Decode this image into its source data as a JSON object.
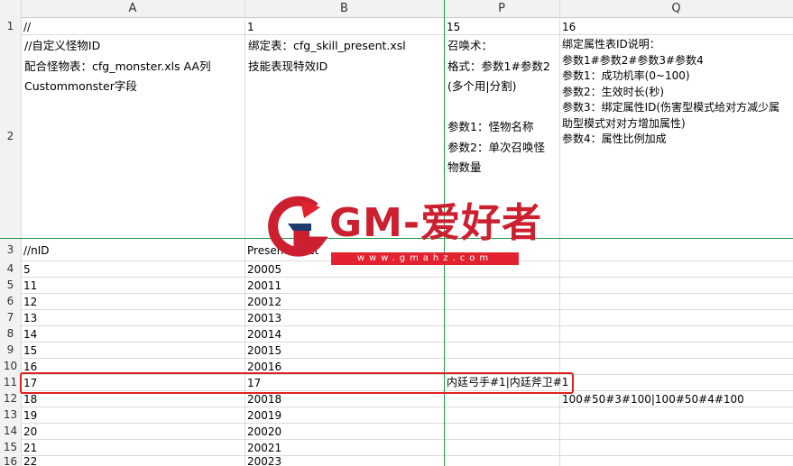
{
  "columns": [
    "A",
    "B",
    "P",
    "Q"
  ],
  "row_numbers": [
    "1",
    "2",
    "3",
    "4",
    "5",
    "6",
    "7",
    "8",
    "9",
    "10",
    "11",
    "12",
    "13",
    "14",
    "15",
    "16"
  ],
  "row1": {
    "A": "//",
    "B": "1",
    "P": "15",
    "Q": "16"
  },
  "row2": {
    "A": [
      "//自定义怪物ID",
      "配合怪物表：cfg_monster.xls  AA列",
      "Custommonster字段"
    ],
    "B": [
      "绑定表：cfg_skill_present.xsl",
      "技能表现特效ID"
    ],
    "P": [
      "召唤术：",
      "格式：参数1#参数2",
      "(多个用|分割)",
      "",
      "参数1：怪物名称",
      "参数2：单次召唤怪",
      "物数量"
    ],
    "Q": [
      "绑定属性表ID说明：",
      "参数1#参数2#参数3#参数4",
      "参数1：成功机率(0~100)",
      "参数2：生效时长(秒)",
      "参数3：绑定属性ID(伤害型模式给对方减少属",
      "助型模式对对方增加属性)",
      "参数4：属性比例加成"
    ]
  },
  "row3": {
    "A": "//nID",
    "B": "Presenteffect"
  },
  "data_rows": [
    {
      "A": "5",
      "B": "20005",
      "P": "",
      "Q": ""
    },
    {
      "A": "11",
      "B": "20011",
      "P": "",
      "Q": ""
    },
    {
      "A": "12",
      "B": "20012",
      "P": "",
      "Q": ""
    },
    {
      "A": "13",
      "B": "20013",
      "P": "",
      "Q": ""
    },
    {
      "A": "14",
      "B": "20014",
      "P": "",
      "Q": ""
    },
    {
      "A": "15",
      "B": "20015",
      "P": "",
      "Q": ""
    },
    {
      "A": "16",
      "B": "20016",
      "P": "",
      "Q": ""
    },
    {
      "A": "17",
      "B": "17",
      "P": "内廷弓手#1|内廷斧卫#1",
      "Q": ""
    },
    {
      "A": "18",
      "B": "20018",
      "P": "",
      "Q": "100#50#3#100|100#50#4#100"
    },
    {
      "A": "19",
      "B": "20019",
      "P": "",
      "Q": ""
    },
    {
      "A": "20",
      "B": "20020",
      "P": "",
      "Q": ""
    },
    {
      "A": "21",
      "B": "20021",
      "P": "",
      "Q": ""
    },
    {
      "A": "22",
      "B": "20023",
      "P": "",
      "Q": ""
    }
  ],
  "watermark": {
    "brand": "GM-爱好者",
    "url": "www.gmahz.com"
  },
  "colors": {
    "freeze_line": "#1c9d4b",
    "highlight": "#e0221f",
    "watermark": "#cc1f2f"
  }
}
